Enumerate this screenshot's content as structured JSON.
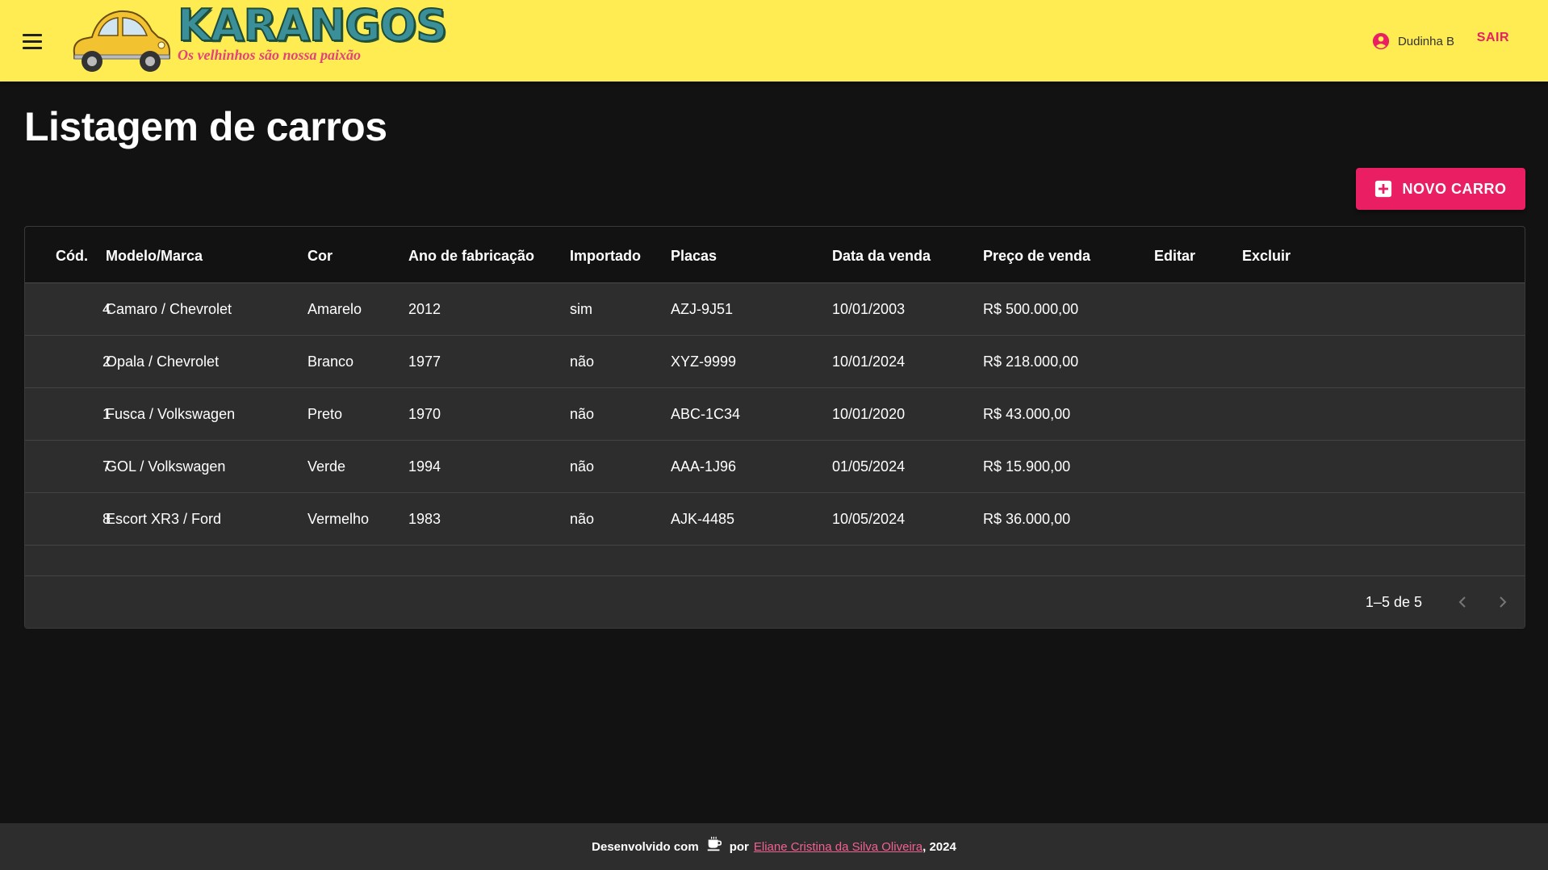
{
  "header": {
    "brand": "KARANGOS",
    "slogan": "Os velhinhos são nossa paixão",
    "user_name": "Dudinha B",
    "logout_label": "SAIR"
  },
  "page": {
    "title": "Listagem de carros",
    "new_button_label": "NOVO CARRO"
  },
  "table": {
    "columns": [
      "Cód.",
      "Modelo/Marca",
      "Cor",
      "Ano de fabricação",
      "Importado",
      "Placas",
      "Data da venda",
      "Preço de venda",
      "Editar",
      "Excluir"
    ],
    "rows": [
      {
        "id": "4",
        "model": "Camaro / Chevrolet",
        "color": "Amarelo",
        "year": "2012",
        "imported": "sim",
        "plate": "AZJ-9J51",
        "sale_date": "10/01/2003",
        "price": "R$ 500.000,00"
      },
      {
        "id": "2",
        "model": "Opala / Chevrolet",
        "color": "Branco",
        "year": "1977",
        "imported": "não",
        "plate": "XYZ-9999",
        "sale_date": "10/01/2024",
        "price": "R$ 218.000,00"
      },
      {
        "id": "1",
        "model": "Fusca / Volkswagen",
        "color": "Preto",
        "year": "1970",
        "imported": "não",
        "plate": "ABC-1C34",
        "sale_date": "10/01/2020",
        "price": "R$ 43.000,00"
      },
      {
        "id": "7",
        "model": "GOL / Volkswagen",
        "color": "Verde",
        "year": "1994",
        "imported": "não",
        "plate": "AAA-1J96",
        "sale_date": "01/05/2024",
        "price": "R$ 15.900,00"
      },
      {
        "id": "8",
        "model": "Escort XR3 / Ford",
        "color": "Vermelho",
        "year": "1983",
        "imported": "não",
        "plate": "AJK-4485",
        "sale_date": "10/05/2024",
        "price": "R$ 36.000,00"
      }
    ],
    "pagination": "1–5 de 5"
  },
  "footer": {
    "prefix": "Desenvolvido com",
    "middle": "por",
    "author": "Eliane Cristina da Silva Oliveira",
    "suffix": ", 2024"
  },
  "colors": {
    "header_bg": "#ffeb52",
    "accent": "#e91e63",
    "page_bg": "#121212",
    "row_bg": "#2d2d2d"
  },
  "icons": [
    "menu-icon",
    "car-logo-icon",
    "account-circle-icon",
    "add-box-icon",
    "chevron-left-icon",
    "chevron-right-icon",
    "coffee-cup-icon"
  ]
}
